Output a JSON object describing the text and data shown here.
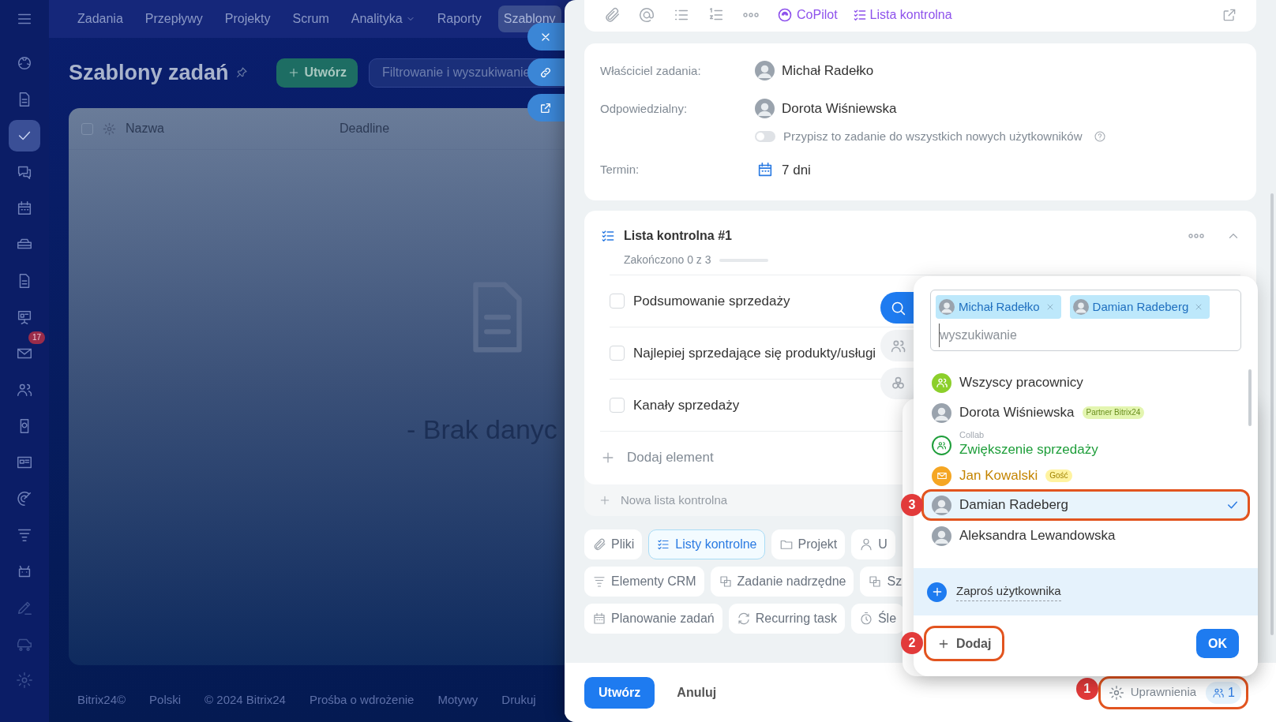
{
  "top_nav": {
    "items": [
      {
        "label": "Zadania",
        "selected": false,
        "has_menu": false
      },
      {
        "label": "Przepływy",
        "selected": false,
        "has_menu": false
      },
      {
        "label": "Projekty",
        "selected": false,
        "has_menu": false
      },
      {
        "label": "Scrum",
        "selected": false,
        "has_menu": false
      },
      {
        "label": "Analityka",
        "selected": false,
        "has_menu": true
      },
      {
        "label": "Raporty",
        "selected": false,
        "has_menu": false
      },
      {
        "label": "Szablony",
        "selected": true,
        "has_menu": false
      }
    ]
  },
  "sidebar": {
    "items": [
      {
        "selected": false
      },
      {
        "selected": false
      },
      {
        "selected": true
      },
      {
        "selected": false
      },
      {
        "selected": false
      },
      {
        "selected": false
      },
      {
        "selected": false
      },
      {
        "selected": false
      },
      {
        "selected": false,
        "badge": "17"
      },
      {
        "selected": false
      },
      {
        "selected": false
      },
      {
        "selected": false
      },
      {
        "selected": false
      },
      {
        "selected": false
      },
      {
        "selected": false
      },
      {
        "selected": false
      },
      {
        "selected": false
      },
      {
        "selected": false
      }
    ]
  },
  "page": {
    "title": "Szablony zadań",
    "create_button": "Utwórz",
    "filter": {
      "placeholder": "Filtrowanie i wyszukiwanie"
    }
  },
  "table": {
    "header_checkbox": {
      "checked": false
    },
    "columns": [
      "Nazwa",
      "Deadline"
    ],
    "empty_text": "- Brak danyc"
  },
  "footer_links": [
    "Bitrix24©",
    "Polski",
    "© 2024 Bitrix24",
    "Prośba o wdrożenie",
    "Motywy",
    "Drukuj"
  ],
  "panel": {
    "toolbar": {
      "copilot": "CoPilot",
      "checklist": "Lista kontrolna"
    },
    "people_fields": [
      {
        "label": "Właściciel zadania:",
        "value": "Michał Radełko"
      },
      {
        "label": "Odpowiedzialny:",
        "value": "Dorota Wiśniewska"
      }
    ],
    "assign_all": {
      "label": "Przypisz to zadanie do wszystkich nowych użytkowników",
      "on": false
    },
    "deadline": {
      "label": "Termin:",
      "value": "7 dni"
    },
    "checklist": {
      "title": "Lista kontrolna #1",
      "progress_text": "Zakończono 0 z 3",
      "level": 0,
      "items": [
        {
          "text": "Podsumowanie sprzedaży",
          "checked": false
        },
        {
          "text": "Najlepiej sprzedające się produkty/usługi",
          "checked": false
        },
        {
          "text": "Kanały sprzedaży",
          "checked": false
        }
      ],
      "add_item": "Dodaj element",
      "new_list": "Nowa lista kontrolna"
    },
    "chip_rows": [
      [
        {
          "label": "Pliki",
          "selected": false
        },
        {
          "label": "Listy kontrolne",
          "selected": true
        },
        {
          "label": "Projekt",
          "selected": false
        },
        {
          "label": "U",
          "selected": false
        }
      ],
      [
        {
          "label": "Elementy CRM",
          "selected": false
        },
        {
          "label": "Zadanie nadrzędne",
          "selected": false
        },
        {
          "label": "Sz",
          "selected": false
        }
      ],
      [
        {
          "label": "Planowanie zadań",
          "selected": false
        },
        {
          "label": "Recurring task",
          "selected": false
        },
        {
          "label": "Śle",
          "selected": false
        }
      ]
    ],
    "footer": {
      "create": "Utwórz",
      "cancel": "Anuluj",
      "permissions": {
        "label": "Uprawnienia",
        "count": "1",
        "callout": "1"
      }
    }
  },
  "selector": {
    "tabs": [
      {
        "selected": true
      },
      {
        "selected": false
      },
      {
        "selected": false
      }
    ],
    "tags": [
      {
        "name": "Michał Radełko"
      },
      {
        "name": "Damian Radeberg"
      }
    ],
    "placeholder": "wyszukiwanie",
    "items": [
      {
        "kind": "all",
        "name": "Wszyscy pracownicy",
        "selected": false
      },
      {
        "kind": "user",
        "name": "Dorota Wiśniewska",
        "badge": "Partner Bitrix24",
        "selected": false
      },
      {
        "kind": "collab",
        "caption": "Collab",
        "name": "Zwiększenie sprzedaży",
        "selected": false
      },
      {
        "kind": "guest",
        "name": "Jan Kowalski",
        "badge": "Gość",
        "selected": false
      },
      {
        "kind": "user",
        "name": "Damian Radeberg",
        "selected": true,
        "callout": "3"
      },
      {
        "kind": "user",
        "name": "Aleksandra Lewandowska",
        "selected": false
      }
    ],
    "invite": "Zaproś użytkownika",
    "add_button": {
      "label": "Dodaj",
      "callout": "2"
    },
    "ok": "OK"
  }
}
